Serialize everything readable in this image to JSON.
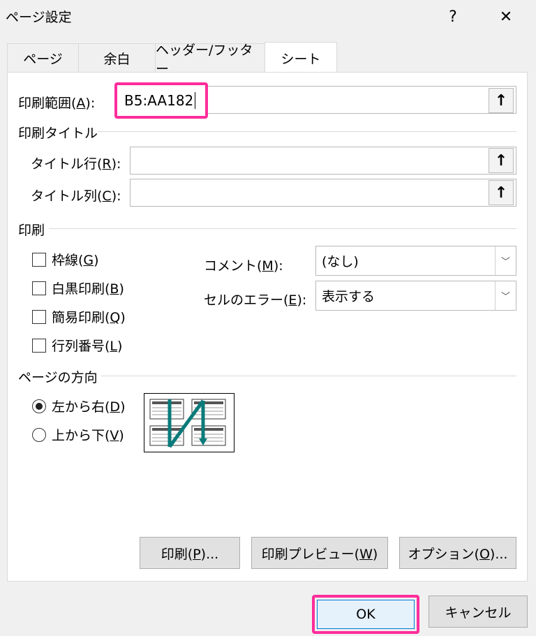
{
  "window": {
    "title": "ページ設定",
    "help_label": "?",
    "close_label": "✕"
  },
  "tabs": [
    {
      "label": "ページ"
    },
    {
      "label": "余白"
    },
    {
      "label": "ヘッダー/フッター"
    },
    {
      "label": "シート",
      "active": true
    }
  ],
  "print_area": {
    "label_prefix": "印刷範囲(",
    "label_key": "A",
    "label_suffix": "):",
    "value": "B5:AA182",
    "ref_icon": "↑"
  },
  "print_titles": {
    "group_label": "印刷タイトル",
    "rows_label_prefix": "タイトル行(",
    "rows_key": "R",
    "rows_suffix": "):",
    "rows_value": "",
    "cols_label_prefix": "タイトル列(",
    "cols_key": "C",
    "cols_suffix": "):",
    "cols_value": "",
    "ref_icon": "↑"
  },
  "print": {
    "group_label": "印刷",
    "checkboxes": [
      {
        "prefix": "枠線(",
        "key": "G",
        "suffix": ")",
        "checked": false
      },
      {
        "prefix": "白黒印刷(",
        "key": "B",
        "suffix": ")",
        "checked": false
      },
      {
        "prefix": "簡易印刷(",
        "key": "Q",
        "suffix": ")",
        "checked": false
      },
      {
        "prefix": "行列番号(",
        "key": "L",
        "suffix": ")",
        "checked": false
      }
    ],
    "comments_prefix": "コメント(",
    "comments_key": "M",
    "comments_suffix": "):",
    "comments_value": "(なし)",
    "errors_prefix": "セルのエラー(",
    "errors_key": "E",
    "errors_suffix": "):",
    "errors_value": "表示する"
  },
  "page_order": {
    "group_label": "ページの方向",
    "option1_prefix": "左から右(",
    "option1_key": "D",
    "option1_suffix": ")",
    "option1_selected": true,
    "option2_prefix": "上から下(",
    "option2_key": "V",
    "option2_suffix": ")",
    "option2_selected": false
  },
  "panel_buttons": {
    "print_prefix": "印刷(",
    "print_key": "P",
    "print_suffix": ")...",
    "preview_prefix": "印刷プレビュー(",
    "preview_key": "W",
    "preview_suffix": ")",
    "options_prefix": "オプション(",
    "options_key": "O",
    "options_suffix": ")..."
  },
  "footer": {
    "ok_label": "OK",
    "cancel_label": "キャンセル"
  },
  "colors": {
    "highlight": "#ff2d9b",
    "ok_button": "#e5f1fb",
    "arrow": "#0a7a7a"
  }
}
